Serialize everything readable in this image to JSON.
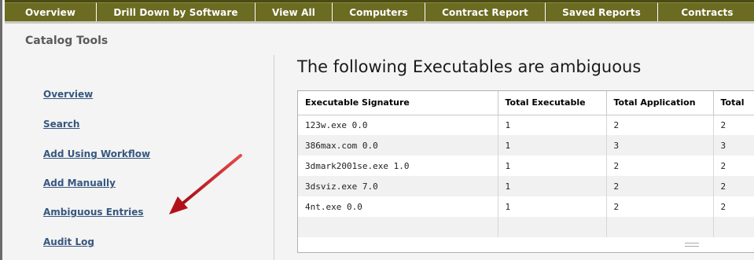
{
  "nav": {
    "tabs": [
      {
        "label": "Overview"
      },
      {
        "label": "Drill Down by Software"
      },
      {
        "label": "View All"
      },
      {
        "label": "Computers"
      },
      {
        "label": "Contract Report"
      },
      {
        "label": "Saved Reports"
      },
      {
        "label": "Contracts"
      }
    ]
  },
  "sidebar": {
    "title": "Catalog Tools",
    "links": [
      {
        "label": "Overview"
      },
      {
        "label": "Search"
      },
      {
        "label": "Add Using Workflow"
      },
      {
        "label": "Add Manually"
      },
      {
        "label": "Ambiguous Entries"
      },
      {
        "label": "Audit Log"
      }
    ]
  },
  "main": {
    "title": "The following Executables are ambiguous",
    "table": {
      "headers": [
        "Executable Signature",
        "Total Executable",
        "Total Application",
        "Total"
      ],
      "rows": [
        [
          "123w.exe 0.0",
          "1",
          "2",
          "2"
        ],
        [
          "386max.com 0.0",
          "1",
          "3",
          "3"
        ],
        [
          "3dmark2001se.exe 1.0",
          "1",
          "2",
          "2"
        ],
        [
          "3dsviz.exe 7.0",
          "1",
          "2",
          "2"
        ],
        [
          "4nt.exe 0.0",
          "1",
          "2",
          "2"
        ]
      ]
    }
  },
  "annotation": {
    "arrow_color": "#c0121c"
  }
}
